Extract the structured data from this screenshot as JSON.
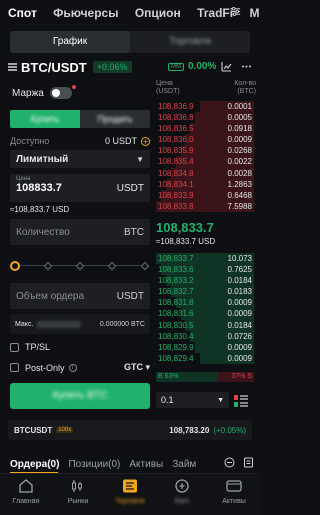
{
  "top_tabs": [
    "Спот",
    "Фьючерсы",
    "Опцион",
    "TradFi",
    "Марж"
  ],
  "view_toggle": {
    "chart": "График",
    "trading": "Торговля"
  },
  "pair": {
    "symbol": "BTC/USDT",
    "change": "+0.06%",
    "mm_tag": "MM",
    "mm_value": "0.00%"
  },
  "form": {
    "margin_label": "Маржа",
    "buy_label": "Купить",
    "sell_label": "Продать",
    "available_label": "Доступно",
    "available_value": "0 USDT",
    "order_type": "Лимитный",
    "price_label": "Цена",
    "price_value": "108833.7",
    "price_unit": "USDT",
    "price_usd": "≈108,833.7 USD",
    "qty_placeholder": "Количество",
    "qty_unit": "BTC",
    "total_placeholder": "Объем ордера",
    "total_unit": "USDT",
    "max_label": "Макс.",
    "max_value": "0.000000 BTC",
    "tpsl_label": "TP/SL",
    "postonly_label": "Post-Only",
    "tif": "GTC",
    "submit_label": "Купить BTC"
  },
  "orderbook": {
    "price_header": "Цена\n(USDT)",
    "qty_header": "Кол-во\n(BTC)",
    "asks": [
      {
        "price": "108,836.9",
        "qty": "0.0001",
        "depth": 0.55
      },
      {
        "price": "108,836.8",
        "qty": "0.0005",
        "depth": 0.6
      },
      {
        "price": "108,836.5",
        "qty": "0.0918",
        "depth": 0.65
      },
      {
        "price": "108,836.0",
        "qty": "0.0009",
        "depth": 0.7
      },
      {
        "price": "108,835.9",
        "qty": "0.0268",
        "depth": 0.75
      },
      {
        "price": "108,835.4",
        "qty": "0.0022",
        "depth": 0.8
      },
      {
        "price": "108,834.8",
        "qty": "0.0028",
        "depth": 0.85
      },
      {
        "price": "108,834.1",
        "qty": "1.2863",
        "depth": 0.9
      },
      {
        "price": "108,833.9",
        "qty": "0.6468",
        "depth": 0.95
      },
      {
        "price": "108,833.8",
        "qty": "7.5988",
        "depth": 1.0
      }
    ],
    "last_price": "108,833.7",
    "last_price_usd": "≈108,833.7 USD",
    "bids": [
      {
        "price": "108,833.7",
        "qty": "10.073",
        "depth": 1.0
      },
      {
        "price": "108,833.6",
        "qty": "0.7625",
        "depth": 0.95
      },
      {
        "price": "108,833.2",
        "qty": "0.0184",
        "depth": 0.9
      },
      {
        "price": "108,832.7",
        "qty": "0.0183",
        "depth": 0.85
      },
      {
        "price": "108,831.8",
        "qty": "0.0009",
        "depth": 0.8
      },
      {
        "price": "108,831.6",
        "qty": "0.0009",
        "depth": 0.75
      },
      {
        "price": "108,830.5",
        "qty": "0.0184",
        "depth": 0.7
      },
      {
        "price": "108,830.4",
        "qty": "0.0726",
        "depth": 0.65
      },
      {
        "price": "108,829.9",
        "qty": "0.0009",
        "depth": 0.6
      },
      {
        "price": "108,829.4",
        "qty": "0.0009",
        "depth": 0.55
      }
    ],
    "buy_tag": "B",
    "buy_ratio": "63%",
    "sell_ratio": "37%",
    "sell_tag": "S",
    "buy_ratio_value": 0.63,
    "tick_size": "0.1"
  },
  "ticker_strip": {
    "symbol": "BTCUSDT",
    "leverage": "100x",
    "price": "108,783.20",
    "change": "(+0.05%)"
  },
  "order_tabs": [
    "Ордера(0)",
    "Позиции(0)",
    "Активы",
    "Займ"
  ],
  "nav": [
    {
      "label": "Главная",
      "icon": "home-icon"
    },
    {
      "label": "Рынки",
      "icon": "markets-icon"
    },
    {
      "label": "Торговля",
      "icon": "trade-icon"
    },
    {
      "label": "Earn",
      "icon": "earn-icon"
    },
    {
      "label": "Активы",
      "icon": "wallet-icon"
    }
  ],
  "colors": {
    "buy": "#20b26c",
    "sell": "#e0424b",
    "accent": "#f0a81f",
    "bg": "#0e0f12"
  }
}
